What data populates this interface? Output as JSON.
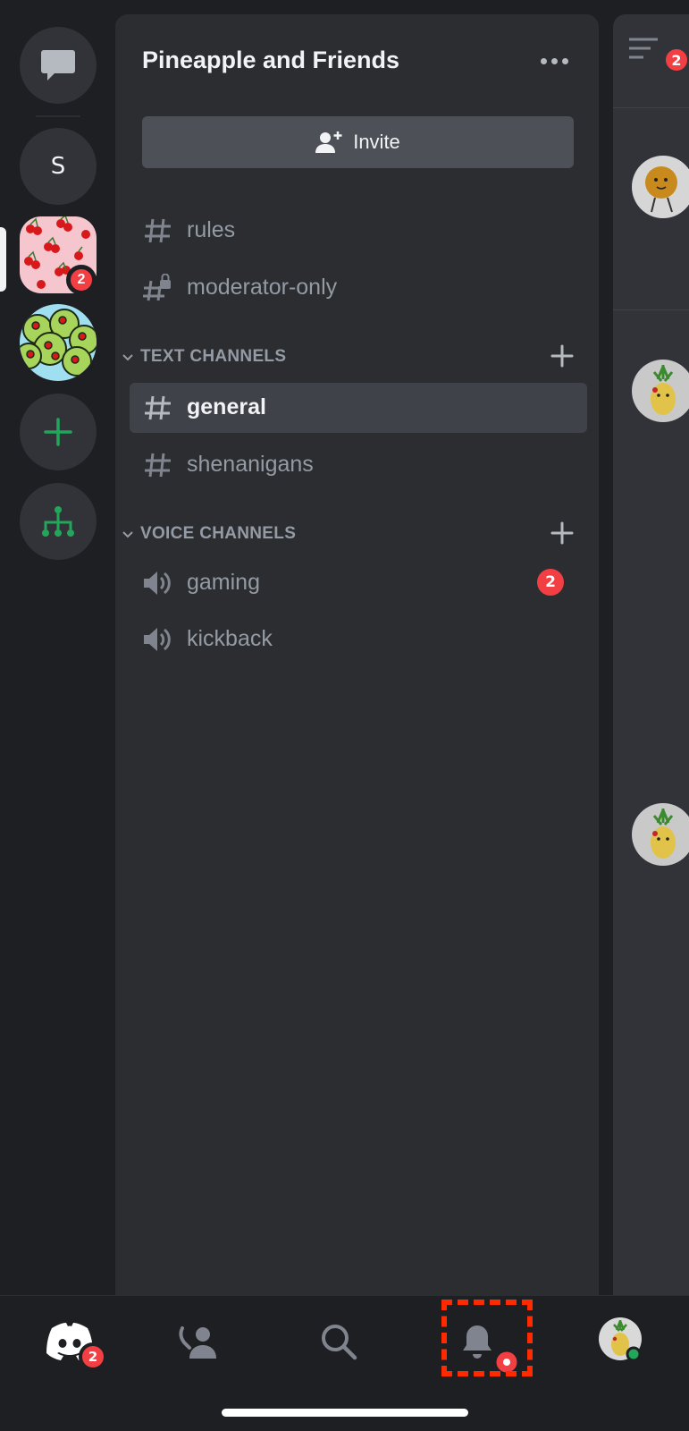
{
  "server": {
    "name": "Pineapple and Friends",
    "invite_label": "Invite"
  },
  "rail": {
    "letter_server": "S",
    "cherry_badge": "2"
  },
  "channels_top": [
    {
      "label": "rules",
      "icon": "hash-icon"
    },
    {
      "label": "moderator-only",
      "icon": "locked-hash-icon"
    }
  ],
  "text_category": {
    "label": "TEXT CHANNELS",
    "channels": [
      {
        "label": "general",
        "icon": "hash-icon",
        "active": true
      },
      {
        "label": "shenanigans",
        "icon": "hash-icon"
      }
    ]
  },
  "voice_category": {
    "label": "VOICE CHANNELS",
    "channels": [
      {
        "label": "gaming",
        "icon": "speaker-icon",
        "badge": "2"
      },
      {
        "label": "kickback",
        "icon": "speaker-icon"
      }
    ]
  },
  "peek": {
    "members_badge": "2"
  },
  "tabbar": {
    "home_badge": "2"
  },
  "colors": {
    "background": "#1e1f22",
    "panel": "#2b2d31",
    "active_channel": "#404249",
    "badge_red": "#f23f43",
    "green_accent": "#23a55a",
    "highlight_dash": "#ff2a00"
  }
}
